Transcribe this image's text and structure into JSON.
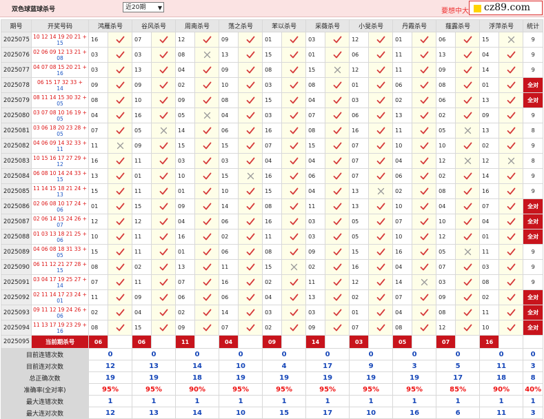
{
  "header": {
    "title": "双色球蓝球杀号",
    "period_select": "近20期",
    "slogan": "要想中大",
    "logo_text": "cz89.com"
  },
  "columns": {
    "period": "期号",
    "draw": "开奖号码",
    "methods": [
      "鸿雁杀号",
      "谷风杀号",
      "周南杀号",
      "荡之杀号",
      "苯以杀号",
      "采薇杀号",
      "小旻杀号",
      "丹霞杀号",
      "薤露杀号",
      "浮萍杀号"
    ],
    "stat": "统计"
  },
  "rows": [
    {
      "period": "2025075",
      "red": "10 12 14 19 20 21 +",
      "blue": "15",
      "kills": [
        "16",
        "07",
        "12",
        "09",
        "01",
        "03",
        "12",
        "01",
        "06",
        "15"
      ],
      "ok": [
        1,
        1,
        1,
        1,
        1,
        1,
        1,
        1,
        1,
        0
      ],
      "count": "9"
    },
    {
      "period": "2025076",
      "red": "02 06 09 12 13 21 +",
      "blue": "08",
      "kills": [
        "03",
        "03",
        "08",
        "13",
        "15",
        "01",
        "06",
        "11",
        "13",
        "04"
      ],
      "ok": [
        1,
        1,
        0,
        1,
        1,
        1,
        1,
        1,
        1,
        1
      ],
      "count": "9"
    },
    {
      "period": "2025077",
      "red": "04 07 08 15 20 21 +",
      "blue": "16",
      "kills": [
        "03",
        "13",
        "04",
        "09",
        "08",
        "15",
        "12",
        "11",
        "09",
        "14"
      ],
      "ok": [
        1,
        1,
        1,
        1,
        1,
        0,
        1,
        1,
        1,
        1
      ],
      "count": "9"
    },
    {
      "period": "2025078",
      "red": "06 15 17 32 33 +",
      "blue": "14",
      "kills": [
        "09",
        "09",
        "02",
        "10",
        "03",
        "08",
        "01",
        "06",
        "08",
        "01"
      ],
      "ok": [
        1,
        1,
        1,
        1,
        1,
        1,
        1,
        1,
        1,
        1
      ],
      "count": "全对"
    },
    {
      "period": "2025079",
      "red": "08 11 14 15 30 32 +",
      "blue": "05",
      "kills": [
        "08",
        "10",
        "09",
        "08",
        "15",
        "04",
        "03",
        "02",
        "06",
        "13"
      ],
      "ok": [
        1,
        1,
        1,
        1,
        1,
        1,
        1,
        1,
        1,
        1
      ],
      "count": "全对"
    },
    {
      "period": "2025080",
      "red": "03 07 08 10 16 19 +",
      "blue": "05",
      "kills": [
        "04",
        "16",
        "05",
        "04",
        "03",
        "07",
        "06",
        "13",
        "02",
        "09"
      ],
      "ok": [
        1,
        1,
        0,
        1,
        1,
        1,
        1,
        1,
        1,
        1
      ],
      "count": "9"
    },
    {
      "period": "2025081",
      "red": "03 06 18 20 23 28 +",
      "blue": "05",
      "kills": [
        "07",
        "05",
        "14",
        "06",
        "16",
        "08",
        "16",
        "11",
        "05",
        "13"
      ],
      "ok": [
        1,
        0,
        1,
        1,
        1,
        1,
        1,
        1,
        0,
        1
      ],
      "count": "8"
    },
    {
      "period": "2025082",
      "red": "04 06 09 14 32 33 +",
      "blue": "11",
      "kills": [
        "11",
        "09",
        "15",
        "15",
        "07",
        "15",
        "07",
        "10",
        "10",
        "02"
      ],
      "ok": [
        0,
        1,
        1,
        1,
        1,
        1,
        1,
        1,
        1,
        1
      ],
      "count": "9"
    },
    {
      "period": "2025083",
      "red": "10 15 16 17 27 29 +",
      "blue": "12",
      "kills": [
        "16",
        "11",
        "03",
        "03",
        "04",
        "04",
        "07",
        "04",
        "12",
        "12"
      ],
      "ok": [
        1,
        1,
        1,
        1,
        1,
        1,
        1,
        1,
        0,
        0
      ],
      "count": "8"
    },
    {
      "period": "2025084",
      "red": "06 08 10 14 24 33 +",
      "blue": "15",
      "kills": [
        "13",
        "01",
        "10",
        "15",
        "16",
        "06",
        "07",
        "06",
        "02",
        "14"
      ],
      "ok": [
        1,
        1,
        1,
        0,
        1,
        1,
        1,
        1,
        1,
        1
      ],
      "count": "9"
    },
    {
      "period": "2025085",
      "red": "11 14 15 18 21 24 +",
      "blue": "13",
      "kills": [
        "15",
        "11",
        "01",
        "10",
        "15",
        "04",
        "13",
        "02",
        "08",
        "16"
      ],
      "ok": [
        1,
        1,
        1,
        1,
        1,
        1,
        0,
        1,
        1,
        1
      ],
      "count": "9"
    },
    {
      "period": "2025086",
      "red": "02 06 08 10 17 24 +",
      "blue": "06",
      "kills": [
        "01",
        "15",
        "09",
        "14",
        "08",
        "11",
        "13",
        "10",
        "04",
        "07"
      ],
      "ok": [
        1,
        1,
        1,
        1,
        1,
        1,
        1,
        1,
        1,
        1
      ],
      "count": "全对"
    },
    {
      "period": "2025087",
      "red": "02 06 14 15 24 26 +",
      "blue": "07",
      "kills": [
        "12",
        "12",
        "04",
        "06",
        "16",
        "03",
        "05",
        "07",
        "10",
        "04"
      ],
      "ok": [
        1,
        1,
        1,
        1,
        1,
        1,
        1,
        1,
        1,
        1
      ],
      "count": "全对"
    },
    {
      "period": "2025088",
      "red": "01 03 13 18 21 25 +",
      "blue": "06",
      "kills": [
        "10",
        "11",
        "16",
        "02",
        "11",
        "03",
        "05",
        "10",
        "12",
        "01"
      ],
      "ok": [
        1,
        1,
        1,
        1,
        1,
        1,
        1,
        1,
        1,
        1
      ],
      "count": "全对"
    },
    {
      "period": "2025089",
      "red": "04 06 08 18 31 33 +",
      "blue": "05",
      "kills": [
        "15",
        "11",
        "01",
        "06",
        "08",
        "09",
        "15",
        "16",
        "05",
        "11"
      ],
      "ok": [
        1,
        1,
        1,
        1,
        1,
        1,
        1,
        1,
        0,
        1
      ],
      "count": "9"
    },
    {
      "period": "2025090",
      "red": "06 11 12 21 27 28 +",
      "blue": "15",
      "kills": [
        "08",
        "02",
        "13",
        "11",
        "15",
        "02",
        "16",
        "04",
        "07",
        "03"
      ],
      "ok": [
        1,
        1,
        1,
        1,
        0,
        1,
        1,
        1,
        1,
        1
      ],
      "count": "9"
    },
    {
      "period": "2025091",
      "red": "03 04 17 19 25 27 +",
      "blue": "14",
      "kills": [
        "07",
        "11",
        "07",
        "16",
        "02",
        "11",
        "12",
        "14",
        "03",
        "08"
      ],
      "ok": [
        1,
        1,
        1,
        1,
        1,
        1,
        1,
        0,
        1,
        1
      ],
      "count": "9"
    },
    {
      "period": "2025092",
      "red": "02 11 14 17 23 24 +",
      "blue": "01",
      "kills": [
        "11",
        "09",
        "06",
        "06",
        "04",
        "13",
        "02",
        "07",
        "09",
        "02"
      ],
      "ok": [
        1,
        1,
        1,
        1,
        1,
        1,
        1,
        1,
        1,
        1
      ],
      "count": "全对"
    },
    {
      "period": "2025093",
      "red": "09 11 12 19 24 26 +",
      "blue": "06",
      "kills": [
        "02",
        "04",
        "02",
        "14",
        "03",
        "03",
        "01",
        "04",
        "08",
        "11"
      ],
      "ok": [
        1,
        1,
        1,
        1,
        1,
        1,
        1,
        1,
        1,
        1
      ],
      "count": "全对"
    },
    {
      "period": "2025094",
      "red": "11 13 17 19 23 29 +",
      "blue": "16",
      "kills": [
        "08",
        "15",
        "09",
        "07",
        "02",
        "09",
        "07",
        "08",
        "12",
        "10"
      ],
      "ok": [
        1,
        1,
        1,
        1,
        1,
        1,
        1,
        1,
        1,
        1
      ],
      "count": "全对"
    }
  ],
  "current": {
    "period": "2025095",
    "label": "当前期杀号",
    "kills": [
      "06",
      "06",
      "11",
      "04",
      "09",
      "14",
      "03",
      "05",
      "07",
      "16"
    ]
  },
  "stats": [
    {
      "label": "目前连错次数",
      "values": [
        "0",
        "0",
        "0",
        "0",
        "0",
        "0",
        "0",
        "0",
        "0",
        "0",
        "0"
      ],
      "red": false
    },
    {
      "label": "目前连对次数",
      "values": [
        "12",
        "13",
        "14",
        "10",
        "4",
        "17",
        "9",
        "3",
        "5",
        "11",
        "3"
      ],
      "red": false
    },
    {
      "label": "总正确次数",
      "values": [
        "19",
        "19",
        "18",
        "19",
        "19",
        "19",
        "19",
        "19",
        "17",
        "18",
        "8"
      ],
      "red": false
    },
    {
      "label": "准确率(全对率)",
      "values": [
        "95%",
        "95%",
        "90%",
        "95%",
        "95%",
        "95%",
        "95%",
        "95%",
        "85%",
        "90%",
        "40%"
      ],
      "red": true
    },
    {
      "label": "最大连错次数",
      "values": [
        "1",
        "1",
        "1",
        "1",
        "1",
        "1",
        "1",
        "1",
        "1",
        "1",
        "1"
      ],
      "red": false
    },
    {
      "label": "最大连对次数",
      "values": [
        "12",
        "13",
        "14",
        "10",
        "15",
        "17",
        "10",
        "16",
        "6",
        "11",
        "3"
      ],
      "red": false
    }
  ],
  "colors": {
    "red": "#c8141c",
    "tick": "#d63b3b",
    "cross": "#9a9a9a",
    "blue": "#1546b8"
  }
}
